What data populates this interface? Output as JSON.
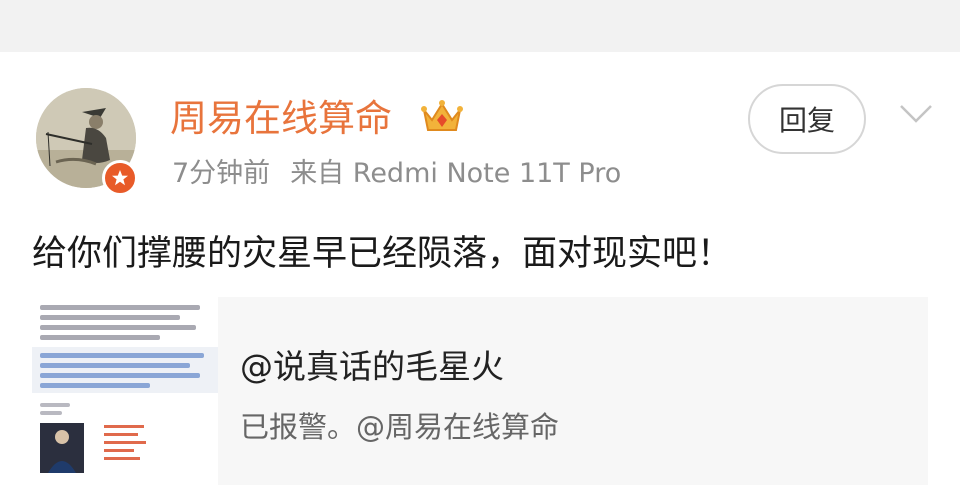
{
  "post": {
    "username": "周易在线算命",
    "time": "7分钟前",
    "source": "来自 Redmi Note 11T Pro",
    "reply_label": "回复",
    "text": "给你们撑腰的灾星早已经陨落，面对现实吧！"
  },
  "quote": {
    "title": "@说真话的毛星火",
    "subtitle": "已报警。@周易在线算命"
  },
  "icons": {
    "badge": "verified-badge-icon",
    "crown": "crown-icon",
    "expand": "chevron-down-icon"
  },
  "colors": {
    "username": "#e8743c",
    "badge": "#e85b29",
    "meta": "#8d8d8d"
  }
}
